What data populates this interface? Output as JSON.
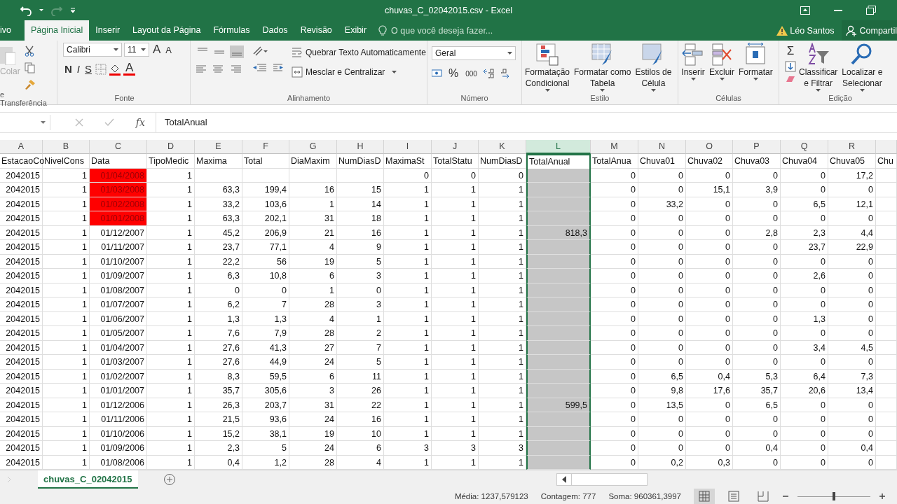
{
  "window": {
    "title": "chuvas_C_02042015.csv - Excel"
  },
  "tabs": [
    {
      "label": "ivo",
      "selected": false
    },
    {
      "label": "Página Inicial",
      "selected": true
    },
    {
      "label": "Inserir",
      "selected": false
    },
    {
      "label": "Layout da Página",
      "selected": false
    },
    {
      "label": "Fórmulas",
      "selected": false
    },
    {
      "label": "Dados",
      "selected": false
    },
    {
      "label": "Revisão",
      "selected": false
    },
    {
      "label": "Exibir",
      "selected": false
    }
  ],
  "tell_me": {
    "placeholder": "O que você deseja fazer..."
  },
  "user": "Léo Santos",
  "share": "Compartil",
  "clipboard": {
    "label": "e Transferência",
    "paste": "Colar",
    "paste_disabled": true
  },
  "font": {
    "label": "Fonte",
    "family": "Calibri",
    "size": "11",
    "grow": "A",
    "shrink": "A",
    "bold": "N",
    "italic": "I",
    "underline": "S",
    "color_button": "A"
  },
  "alignment": {
    "label": "Alinhamento",
    "wrap": "Quebrar Texto Automaticamente",
    "merge": "Mesclar e Centralizar"
  },
  "number": {
    "label": "Número",
    "format": "Geral",
    "percent": "%",
    "thousands": "000"
  },
  "styles": {
    "label": "Estilo",
    "buttons": [
      {
        "lines": [
          "Formatação",
          "Condicional"
        ]
      },
      {
        "lines": [
          "Formatar como",
          "Tabela"
        ]
      },
      {
        "lines": [
          "Estilos de",
          "Célula"
        ]
      }
    ]
  },
  "cells": {
    "label": "Células",
    "buttons": [
      "Inserir",
      "Excluir",
      "Formatar"
    ]
  },
  "editing": {
    "label": "Edição",
    "sum": "Σ",
    "buttons": [
      {
        "lines": [
          "Classificar",
          "e Filtrar"
        ]
      },
      {
        "lines": [
          "Localizar e",
          "Selecionar"
        ]
      }
    ]
  },
  "formula_bar": {
    "fx": "fx",
    "value": "TotalAnual"
  },
  "sheet": {
    "columns": [
      {
        "letter": "A",
        "selected": false
      },
      {
        "letter": "B",
        "selected": false
      },
      {
        "letter": "C",
        "selected": false
      },
      {
        "letter": "D",
        "selected": false
      },
      {
        "letter": "E",
        "selected": false
      },
      {
        "letter": "F",
        "selected": false
      },
      {
        "letter": "G",
        "selected": false
      },
      {
        "letter": "H",
        "selected": false
      },
      {
        "letter": "I",
        "selected": false
      },
      {
        "letter": "J",
        "selected": false
      },
      {
        "letter": "K",
        "selected": false
      },
      {
        "letter": "L",
        "selected": true
      },
      {
        "letter": "M",
        "selected": false
      },
      {
        "letter": "N",
        "selected": false
      },
      {
        "letter": "O",
        "selected": false
      },
      {
        "letter": "P",
        "selected": false
      },
      {
        "letter": "Q",
        "selected": false
      },
      {
        "letter": "R",
        "selected": false
      }
    ],
    "header_cells": [
      "EstacaoCo",
      "NivelCons",
      "Data",
      "TipoMedic",
      "Maxima",
      "Total",
      "DiaMaxim",
      "NumDiasD",
      "MaximaSt",
      "TotalStatu",
      "NumDiasD",
      "TotalAnual",
      "TotalAnua",
      "Chuva01",
      "Chuva02",
      "Chuva03",
      "Chuva04",
      "Chuva05",
      "Chu"
    ],
    "rows": [
      {
        "flagged": true,
        "cells": [
          "2042015",
          "1",
          "01/04/2008",
          "1",
          null,
          null,
          null,
          null,
          "0",
          "0",
          "0",
          null,
          "0",
          "0",
          "0",
          "0",
          "0",
          "17,2"
        ]
      },
      {
        "flagged": true,
        "cells": [
          "2042015",
          "1",
          "01/03/2008",
          "1",
          "63,3",
          "199,4",
          "16",
          "15",
          "1",
          "1",
          "1",
          null,
          "0",
          "0",
          "15,1",
          "3,9",
          "0",
          "0"
        ]
      },
      {
        "flagged": true,
        "cells": [
          "2042015",
          "1",
          "01/02/2008",
          "1",
          "33,2",
          "103,6",
          "1",
          "14",
          "1",
          "1",
          "1",
          null,
          "0",
          "33,2",
          "0",
          "0",
          "6,5",
          "12,1"
        ]
      },
      {
        "flagged": true,
        "cells": [
          "2042015",
          "1",
          "01/01/2008",
          "1",
          "63,3",
          "202,1",
          "31",
          "18",
          "1",
          "1",
          "1",
          null,
          "0",
          "0",
          "0",
          "0",
          "0",
          "0"
        ]
      },
      {
        "flagged": false,
        "cells": [
          "2042015",
          "1",
          "01/12/2007",
          "1",
          "45,2",
          "206,9",
          "21",
          "16",
          "1",
          "1",
          "1",
          "818,3",
          "0",
          "0",
          "0",
          "2,8",
          "2,3",
          "4,4"
        ]
      },
      {
        "flagged": false,
        "cells": [
          "2042015",
          "1",
          "01/11/2007",
          "1",
          "23,7",
          "77,1",
          "4",
          "9",
          "1",
          "1",
          "1",
          null,
          "0",
          "0",
          "0",
          "0",
          "23,7",
          "22,9"
        ]
      },
      {
        "flagged": false,
        "cells": [
          "2042015",
          "1",
          "01/10/2007",
          "1",
          "22,2",
          "56",
          "19",
          "5",
          "1",
          "1",
          "1",
          null,
          "0",
          "0",
          "0",
          "0",
          "0",
          "0"
        ]
      },
      {
        "flagged": false,
        "cells": [
          "2042015",
          "1",
          "01/09/2007",
          "1",
          "6,3",
          "10,8",
          "6",
          "3",
          "1",
          "1",
          "1",
          null,
          "0",
          "0",
          "0",
          "0",
          "2,6",
          "0"
        ]
      },
      {
        "flagged": false,
        "cells": [
          "2042015",
          "1",
          "01/08/2007",
          "1",
          "0",
          "0",
          "1",
          "0",
          "1",
          "1",
          "1",
          null,
          "0",
          "0",
          "0",
          "0",
          "0",
          "0"
        ]
      },
      {
        "flagged": false,
        "cells": [
          "2042015",
          "1",
          "01/07/2007",
          "1",
          "6,2",
          "7",
          "28",
          "3",
          "1",
          "1",
          "1",
          null,
          "0",
          "0",
          "0",
          "0",
          "0",
          "0"
        ]
      },
      {
        "flagged": false,
        "cells": [
          "2042015",
          "1",
          "01/06/2007",
          "1",
          "1,3",
          "1,3",
          "4",
          "1",
          "1",
          "1",
          "1",
          null,
          "0",
          "0",
          "0",
          "0",
          "1,3",
          "0"
        ]
      },
      {
        "flagged": false,
        "cells": [
          "2042015",
          "1",
          "01/05/2007",
          "1",
          "7,6",
          "7,9",
          "28",
          "2",
          "1",
          "1",
          "1",
          null,
          "0",
          "0",
          "0",
          "0",
          "0",
          "0"
        ]
      },
      {
        "flagged": false,
        "cells": [
          "2042015",
          "1",
          "01/04/2007",
          "1",
          "27,6",
          "41,3",
          "27",
          "7",
          "1",
          "1",
          "1",
          null,
          "0",
          "0",
          "0",
          "0",
          "3,4",
          "4,5"
        ]
      },
      {
        "flagged": false,
        "cells": [
          "2042015",
          "1",
          "01/03/2007",
          "1",
          "27,6",
          "44,9",
          "24",
          "5",
          "1",
          "1",
          "1",
          null,
          "0",
          "0",
          "0",
          "0",
          "0",
          "0"
        ]
      },
      {
        "flagged": false,
        "cells": [
          "2042015",
          "1",
          "01/02/2007",
          "1",
          "8,3",
          "59,5",
          "6",
          "11",
          "1",
          "1",
          "1",
          null,
          "0",
          "6,5",
          "0,4",
          "5,3",
          "6,4",
          "7,3"
        ]
      },
      {
        "flagged": false,
        "cells": [
          "2042015",
          "1",
          "01/01/2007",
          "1",
          "35,7",
          "305,6",
          "3",
          "26",
          "1",
          "1",
          "1",
          null,
          "0",
          "9,8",
          "17,6",
          "35,7",
          "20,6",
          "13,4"
        ]
      },
      {
        "flagged": false,
        "cells": [
          "2042015",
          "1",
          "01/12/2006",
          "1",
          "26,3",
          "203,7",
          "31",
          "22",
          "1",
          "1",
          "1",
          "599,5",
          "0",
          "13,5",
          "0",
          "6,5",
          "0",
          "0"
        ]
      },
      {
        "flagged": false,
        "cells": [
          "2042015",
          "1",
          "01/11/2006",
          "1",
          "21,5",
          "93,6",
          "24",
          "16",
          "1",
          "1",
          "1",
          null,
          "0",
          "0",
          "0",
          "0",
          "0",
          "0"
        ]
      },
      {
        "flagged": false,
        "cells": [
          "2042015",
          "1",
          "01/10/2006",
          "1",
          "15,2",
          "38,1",
          "19",
          "10",
          "1",
          "1",
          "1",
          null,
          "0",
          "0",
          "0",
          "0",
          "0",
          "0"
        ]
      },
      {
        "flagged": false,
        "cells": [
          "2042015",
          "1",
          "01/09/2006",
          "1",
          "2,3",
          "5",
          "24",
          "6",
          "3",
          "3",
          "3",
          null,
          "0",
          "0",
          "0",
          "0,4",
          "0",
          "0,4"
        ]
      },
      {
        "flagged": false,
        "cells": [
          "2042015",
          "1",
          "01/08/2006",
          "1",
          "0,4",
          "1,2",
          "28",
          "4",
          "1",
          "1",
          "1",
          null,
          "0",
          "0,2",
          "0,3",
          "0",
          "0",
          "0"
        ]
      }
    ]
  },
  "sheet_tabs": [
    {
      "label": "chuvas_C_02042015",
      "selected": true
    }
  ],
  "zoom": {
    "level": 0.5
  },
  "status_bar": {
    "average": "Média: 1237,579123",
    "count": "Contagem: 777",
    "sum": "Soma: 960361,3997"
  }
}
